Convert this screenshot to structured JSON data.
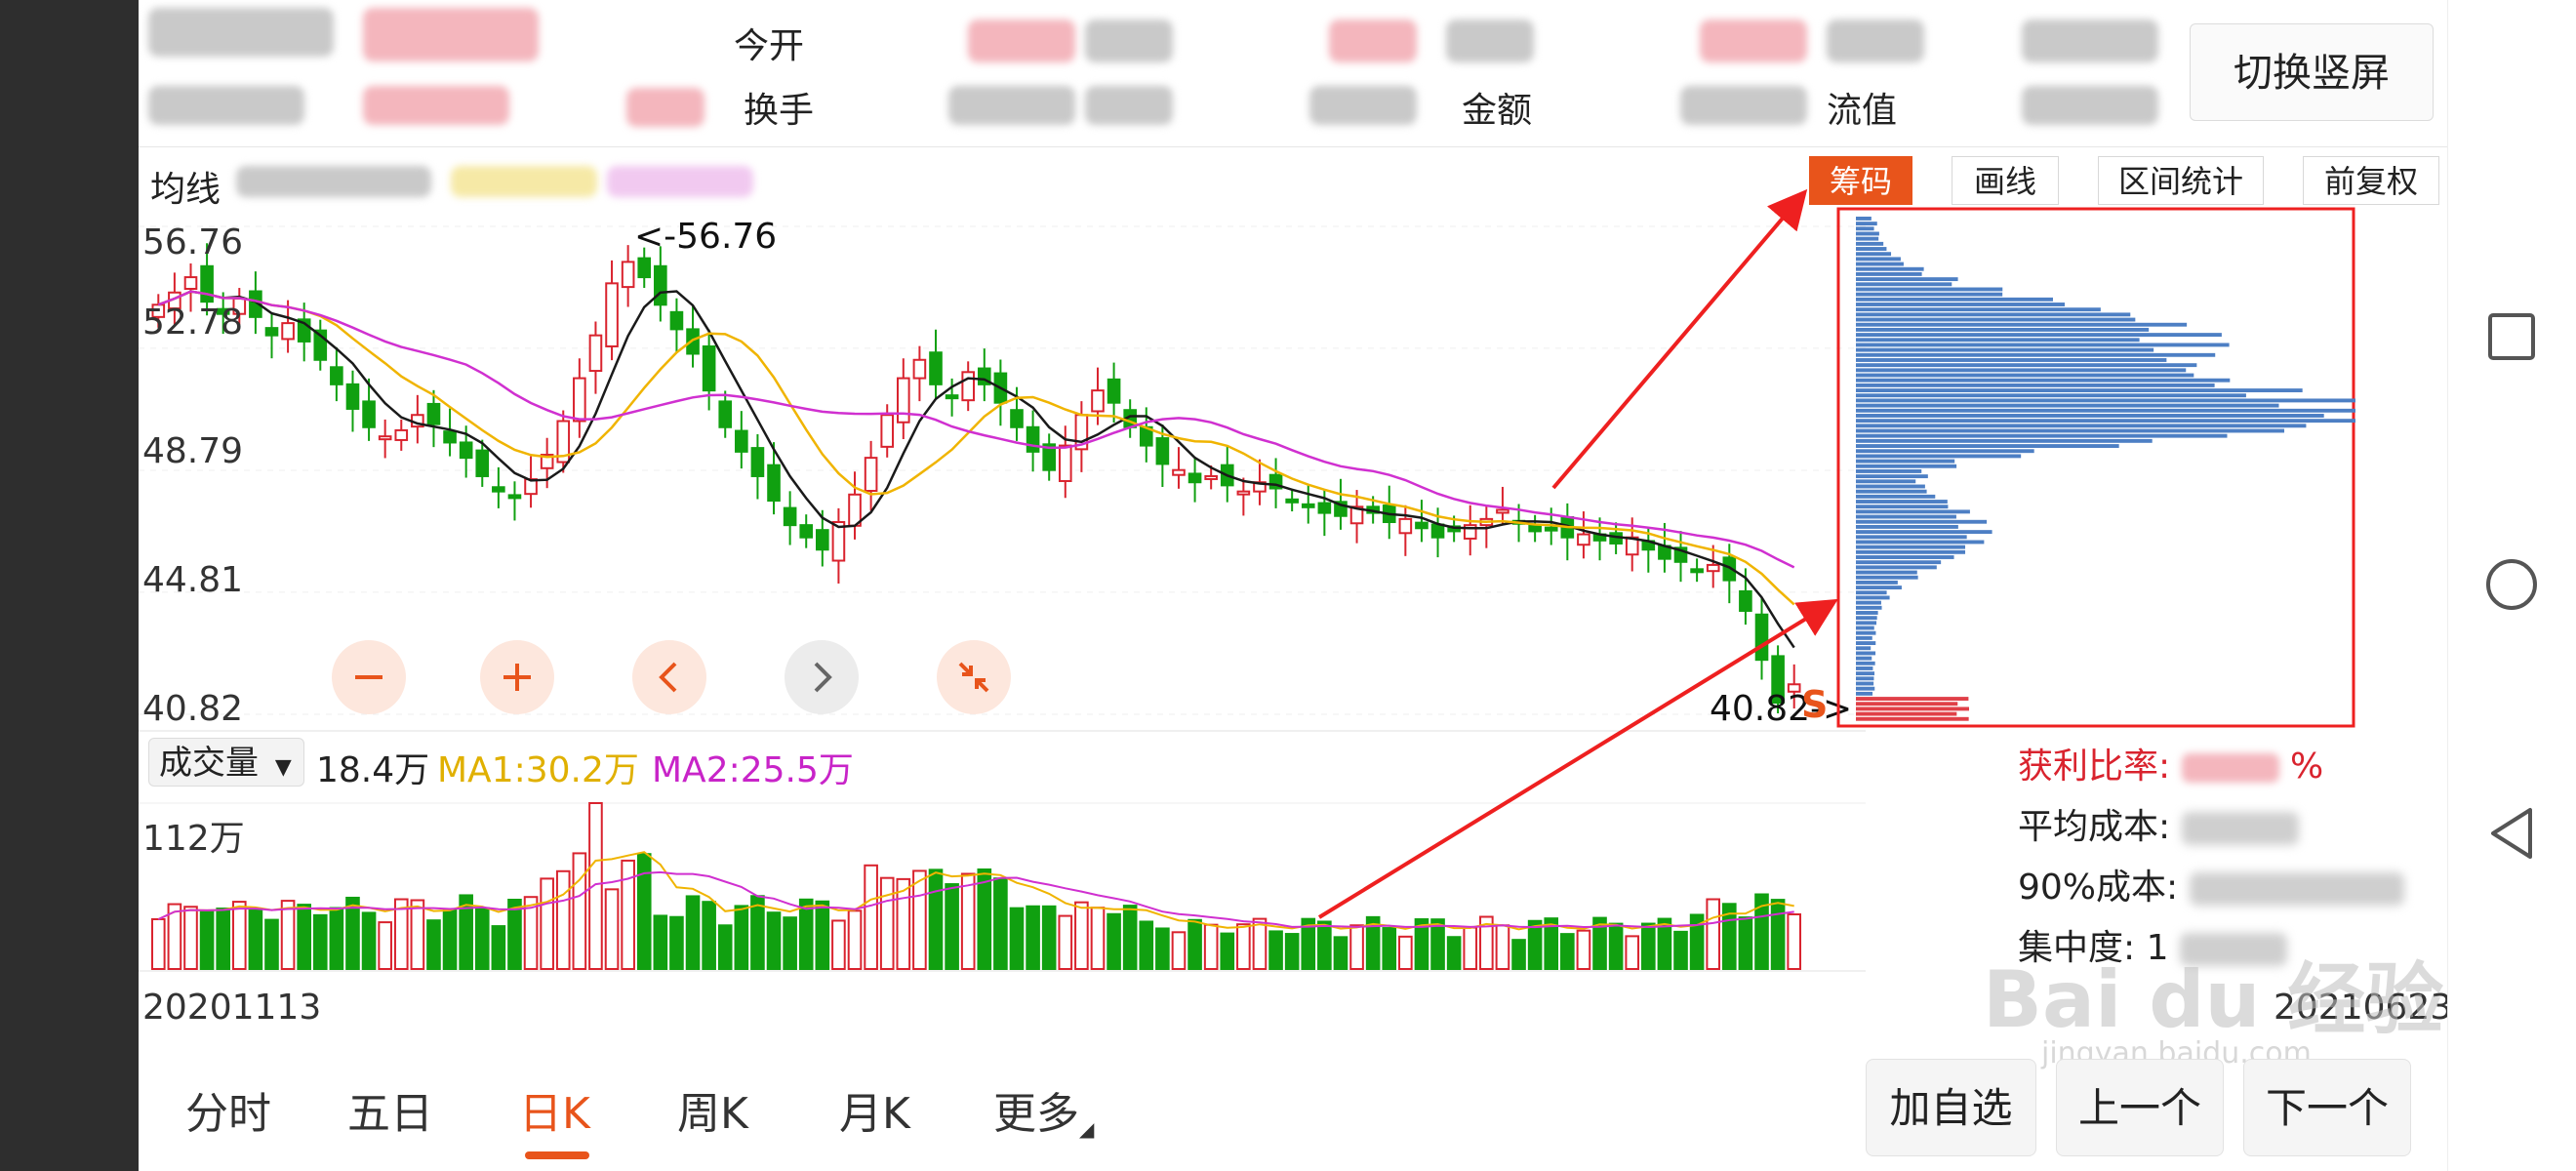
{
  "header": {
    "today_open_label": "今开",
    "turnover_label": "换手",
    "amount_label": "金额",
    "market_value_label": "流值",
    "switch_button": "切换竖屏"
  },
  "ma_bar": {
    "label": "均线"
  },
  "toolbar": {
    "chips": "筹码",
    "draw": "画线",
    "interval": "区间统计",
    "adjust": "前复权"
  },
  "price_axis": [
    "56.76",
    "52.78",
    "48.79",
    "44.81",
    "40.82"
  ],
  "annotations": {
    "high": "<-56.76",
    "low": "40.82->",
    "s_mark": "S"
  },
  "volume": {
    "dropdown": "成交量",
    "current": "18.4万",
    "ma1": "MA1:30.2万",
    "ma2": "MA2:25.5万",
    "axis_max": "112万"
  },
  "dates": {
    "start": "20201113",
    "end": "20210623"
  },
  "chip_info": {
    "profit_ratio_label": "获利比率:",
    "profit_ratio_suffix": "%",
    "avg_cost_label": "平均成本:",
    "cost90_label": "90%成本:",
    "concentration_label": "集中度:",
    "concentration_prefix": "1"
  },
  "bottom_tabs": [
    "分时",
    "五日",
    "日K",
    "周K",
    "月K",
    "更多"
  ],
  "bottom_buttons": {
    "add": "加自选",
    "prev": "上一个",
    "next": "下一个"
  },
  "watermark": {
    "logo": "Bai du 经验",
    "url": "jingyan.baidu.com"
  },
  "colors": {
    "up": "#d9232e",
    "down": "#10a010",
    "ma5": "#1a1a1a",
    "ma10": "#f0b400",
    "ma20": "#d030d0",
    "accent": "#e8541b",
    "chip_blue": "#4d7fc4",
    "chip_red": "#e04048",
    "annotation": "#ee2020"
  },
  "icons": [
    "minus-icon",
    "plus-icon",
    "chevron-left-icon",
    "chevron-right-icon",
    "shrink-icon",
    "square-nav-icon",
    "circle-nav-icon",
    "back-triangle-icon"
  ],
  "chart_data": {
    "type": "candlestick",
    "x_range": [
      "20201113",
      "20210623"
    ],
    "ylim": [
      40.82,
      56.76
    ],
    "y_ticks": [
      56.76,
      52.78,
      48.79,
      44.81,
      40.82
    ],
    "high": 56.76,
    "low": 40.82,
    "close_series": [
      54.2,
      54.6,
      55.1,
      54.3,
      53.9,
      54.4,
      53.8,
      53.2,
      53.6,
      53.0,
      52.4,
      51.6,
      50.8,
      50.2,
      49.9,
      50.1,
      50.6,
      50.3,
      49.7,
      49.2,
      48.6,
      48.1,
      47.9,
      48.5,
      49.3,
      50.4,
      51.8,
      53.2,
      54.9,
      55.6,
      55.1,
      54.2,
      53.4,
      52.6,
      51.4,
      50.2,
      49.4,
      48.6,
      47.8,
      47.0,
      46.6,
      46.2,
      47.1,
      48.0,
      49.2,
      50.6,
      51.8,
      52.4,
      51.6,
      51.2,
      52.0,
      51.6,
      51.0,
      50.2,
      49.4,
      48.8,
      49.6,
      50.6,
      51.4,
      51.0,
      50.2,
      49.6,
      49.0,
      48.8,
      48.4,
      48.6,
      48.3,
      48.1,
      48.4,
      48.2,
      47.8,
      47.6,
      47.4,
      47.3,
      47.6,
      47.4,
      47.1,
      47.2,
      46.9,
      46.6,
      46.8,
      47.0,
      47.2,
      47.5,
      47.1,
      46.8,
      46.9,
      46.6,
      46.7,
      46.5,
      46.4,
      46.6,
      46.2,
      45.9,
      45.8,
      45.5,
      45.7,
      45.2,
      44.2,
      42.6,
      41.2,
      41.8
    ],
    "volume_max": "112万",
    "volume_current": "18.4万",
    "volume_ma1": "30.2万",
    "volume_ma2": "25.5万"
  }
}
